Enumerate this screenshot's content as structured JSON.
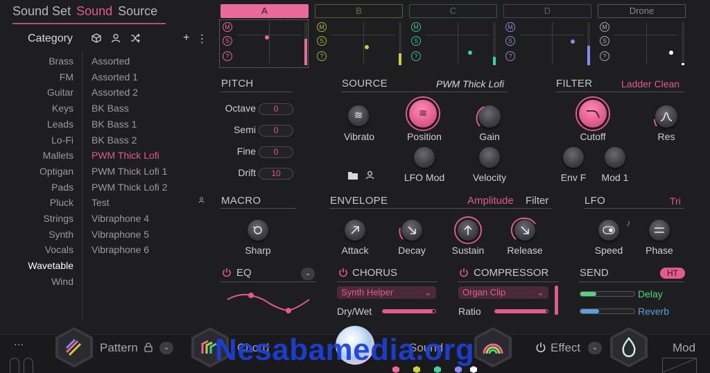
{
  "top_tabs": [
    "Sound Set",
    "Sound",
    "Source"
  ],
  "category": {
    "title": "Category",
    "items": [
      "Brass",
      "FM",
      "Guitar",
      "Keys",
      "Leads",
      "Lo-Fi",
      "Mallets",
      "Optigan",
      "Pads",
      "Pluck",
      "Strings",
      "Synth",
      "Vocals",
      "Wavetable",
      "Wind"
    ],
    "selected": "Wavetable"
  },
  "presets": {
    "items": [
      "Assorted",
      "Assorted 1",
      "Assorted 2",
      "BK Bass",
      "BK Bass 1",
      "BK Bass 2",
      "PWM Thick Lofi",
      "PWM Thick Lofi 1",
      "PWM Thick Lofi 2",
      "Test",
      "Vibraphone 4",
      "Vibraphone 5",
      "Vibraphone 6"
    ],
    "selected": "PWM Thick Lofi",
    "add_label": "+",
    "more_label": "⋮"
  },
  "parts": [
    {
      "name": "A",
      "m": "M",
      "s": "S",
      "q": "?",
      "level": 0.62,
      "color": "#e86a9a"
    },
    {
      "name": "B",
      "m": "M",
      "s": "S",
      "q": "?",
      "level": 0.28,
      "color": "#c8d040"
    },
    {
      "name": "C",
      "m": "M",
      "s": "S",
      "q": "?",
      "level": 0.2,
      "color": "#40d0a0"
    },
    {
      "name": "D",
      "m": "M",
      "s": "S",
      "q": "?",
      "level": 0.45,
      "color": "#8a8af0"
    },
    {
      "name": "Drone",
      "m": "M",
      "s": "S",
      "q": "?",
      "level": 0.05,
      "color": "#ffffff"
    }
  ],
  "pitch": {
    "title": "PITCH",
    "rows": [
      {
        "label": "Octave",
        "value": "0"
      },
      {
        "label": "Semi",
        "value": "0"
      },
      {
        "label": "Fine",
        "value": "0"
      },
      {
        "label": "Drift",
        "value": "10"
      }
    ]
  },
  "source": {
    "title": "SOURCE",
    "preset": "PWM Thick Lofi",
    "knobs": [
      "Vibrato",
      "Position",
      "Gain",
      "LFO Mod",
      "Velocity"
    ]
  },
  "filter": {
    "title": "FILTER",
    "type": "Ladder Clean",
    "knobs": [
      "Cutoff",
      "Res",
      "Env F",
      "Mod 1"
    ]
  },
  "macro": {
    "title": "MACRO",
    "knob": "Sharp"
  },
  "envelope": {
    "title": "ENVELOPE",
    "mode_active": "Amplitude",
    "mode_other": "Filter",
    "knobs": [
      "Attack",
      "Decay",
      "Sustain",
      "Release"
    ]
  },
  "lfo": {
    "title": "LFO",
    "shape": "Tri",
    "knobs": [
      "Speed",
      "Phase"
    ]
  },
  "eq": {
    "title": "EQ"
  },
  "chorus": {
    "title": "CHORUS",
    "preset": "Synth Helper",
    "param": "Dry/Wet",
    "amount": 0.95
  },
  "compressor": {
    "title": "COMPRESSOR",
    "preset": "Organ Clip",
    "param": "Ratio",
    "amount": 0.97
  },
  "send": {
    "title": "SEND",
    "badge": "HT",
    "items": [
      {
        "label": "Delay",
        "level": 0.3,
        "color": "#5ad080"
      },
      {
        "label": "Reverb",
        "level": 0.35,
        "color": "#5aa0e0"
      }
    ]
  },
  "bottom_bar": {
    "more": "···",
    "pattern": "Pattern",
    "chord": "Chord",
    "sound": "Sound",
    "effect": "Effect",
    "mod": "Mod",
    "watermark": "Nesabamedia.org"
  }
}
